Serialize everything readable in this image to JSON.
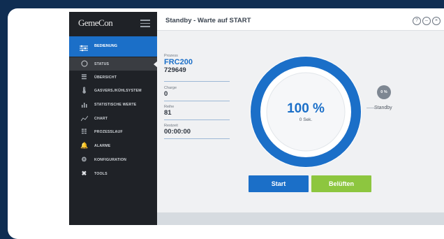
{
  "app": {
    "logo_text": "GemeCon",
    "title": "Standby - Warte auf START"
  },
  "sidebar": {
    "header": {
      "label": "BEDIENUNG",
      "icon": "sliders-icon"
    },
    "items": [
      {
        "label": "STATUS",
        "icon": "circle-icon",
        "active": true
      },
      {
        "label": "ÜBERSICHT",
        "icon": "list-icon"
      },
      {
        "label": "GASVERS./KÜHLSYSTEM",
        "icon": "thermometer-icon"
      },
      {
        "label": "STATISTISCHE WERTE",
        "icon": "bar-chart-icon"
      },
      {
        "label": "CHART",
        "icon": "line-chart-icon"
      },
      {
        "label": "PROZESSLAUF",
        "icon": "process-list-icon"
      },
      {
        "label": "ALARME",
        "icon": "bell-icon"
      },
      {
        "label": "KONFIGURATION",
        "icon": "gear-icon"
      },
      {
        "label": "TOOLS",
        "icon": "tools-icon"
      }
    ]
  },
  "info": {
    "prozess_label": "Prozess",
    "prozess_name": "FRC200",
    "prozess_id": "729649",
    "charge_label": "Charge",
    "charge_value": "0",
    "reihe_label": "Reihe",
    "reihe_value": "81",
    "restzeit_label": "Restzeit",
    "restzeit_value": "00:00:00"
  },
  "progress": {
    "percent_text": "100 %",
    "seconds_text": "0 Sek.",
    "percent": 100,
    "ring_color": "#1b6fc8"
  },
  "standby": {
    "badge_text": "0 %",
    "label": "Standby"
  },
  "buttons": {
    "start": "Start",
    "belueften": "Belüften"
  },
  "window_controls": {
    "help": "?",
    "minimize": "–",
    "close": "×"
  }
}
